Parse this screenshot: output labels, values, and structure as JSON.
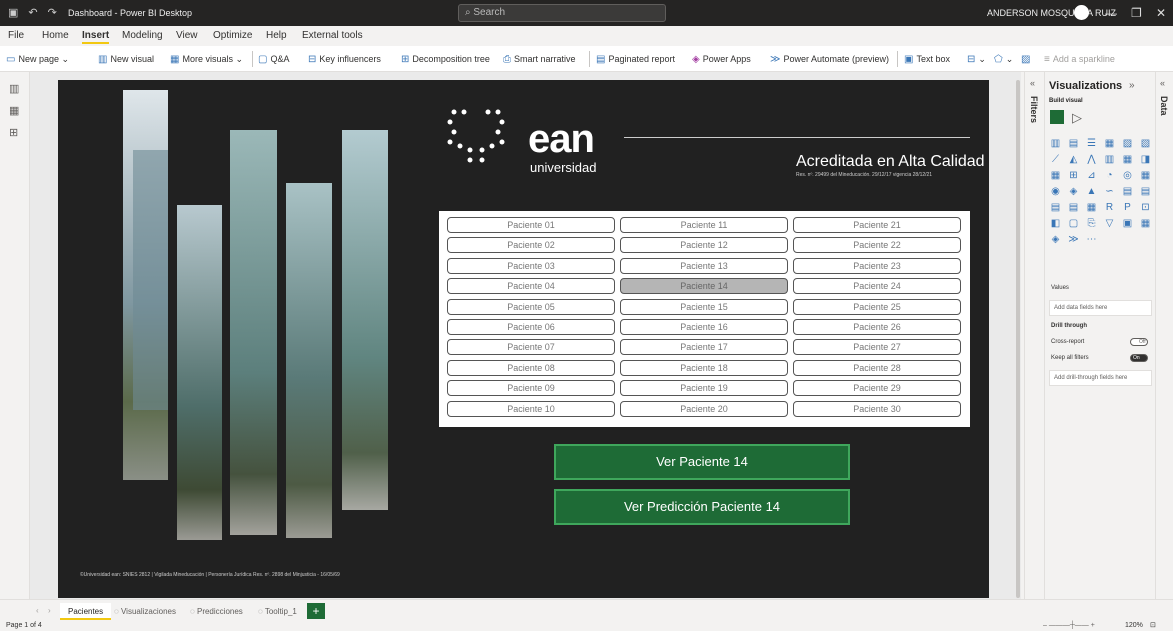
{
  "titlebar": {
    "app_title": "Dashboard - Power BI Desktop",
    "search_placeholder": "Search",
    "user_name": "ANDERSON MOSQUERA RUIZ"
  },
  "menu": [
    "File",
    "Home",
    "Insert",
    "Modeling",
    "View",
    "Optimize",
    "Help",
    "External tools"
  ],
  "ribbon": {
    "new_page": "New page",
    "new_visual": "New visual",
    "more_visuals": "More visuals",
    "qa": "Q&A",
    "key_influencers": "Key influencers",
    "decomposition_tree": "Decomposition tree",
    "smart_narrative": "Smart narrative",
    "paginated_report": "Paginated report",
    "power_apps": "Power Apps",
    "power_automate": "Power Automate (preview)",
    "text_box": "Text box",
    "add_sparkline": "Add a sparkline"
  },
  "report": {
    "logo_text": "ean",
    "logo_sub": "universidad",
    "accreditation": "Acreditada en Alta Calidad",
    "resolution": "Res. nº. 29499 del Mineducación. 29/12/17 vigencia 28/12/21",
    "patients": [
      [
        "Paciente 01",
        "Paciente 11",
        "Paciente 21"
      ],
      [
        "Paciente 02",
        "Paciente 12",
        "Paciente 22"
      ],
      [
        "Paciente 03",
        "Paciente 13",
        "Paciente 23"
      ],
      [
        "Paciente 04",
        "Paciente 14",
        "Paciente 24"
      ],
      [
        "Paciente 05",
        "Paciente 15",
        "Paciente 25"
      ],
      [
        "Paciente 06",
        "Paciente 16",
        "Paciente 26"
      ],
      [
        "Paciente 07",
        "Paciente 17",
        "Paciente 27"
      ],
      [
        "Paciente 08",
        "Paciente 18",
        "Paciente 28"
      ],
      [
        "Paciente 09",
        "Paciente 19",
        "Paciente 29"
      ],
      [
        "Paciente 10",
        "Paciente 20",
        "Paciente 30"
      ]
    ],
    "selected_patient": "Paciente 14",
    "view_patient_button": "Ver Paciente 14",
    "view_prediction_button": "Ver Predicción Paciente 14",
    "footer": "©Universidad ean: SNIES 2812 | Vigilada Mineducación | Personería Jurídica Res. nº. 2898 del Minjusticia - 16/05/69"
  },
  "filters_label": "Filters",
  "visualizations": {
    "title": "Visualizations",
    "build_visual": "Build visual",
    "values_label": "Values",
    "add_data_fields": "Add data fields here",
    "drill_through": "Drill through",
    "cross_report": "Cross-report",
    "cross_report_state": "Off",
    "keep_all_filters": "Keep all filters",
    "keep_all_filters_state": "On",
    "add_drill_fields": "Add drill-through fields here"
  },
  "data_label": "Data",
  "tabs": [
    "Pacientes",
    "Visualizaciones",
    "Predicciones",
    "Tooltip_1"
  ],
  "active_tab": "Pacientes",
  "status": {
    "page": "Page 1 of 4",
    "zoom": "120%"
  },
  "colors": {
    "report_bg": "#212121",
    "button_green": "#1e6b36",
    "button_border": "#3fa75c",
    "accent": "#f2c811"
  }
}
